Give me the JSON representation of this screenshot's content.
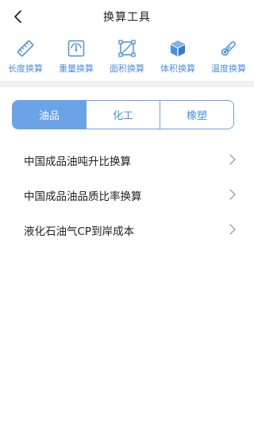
{
  "header": {
    "title": "换算工具"
  },
  "toolbar": {
    "items": [
      {
        "label": "长度换算",
        "icon": "ruler-icon"
      },
      {
        "label": "重量换算",
        "icon": "scale-icon"
      },
      {
        "label": "面积换算",
        "icon": "area-icon"
      },
      {
        "label": "体积换算",
        "icon": "cube-icon"
      },
      {
        "label": "温度换算",
        "icon": "thermometer-icon"
      }
    ]
  },
  "tabs": [
    {
      "label": "油品",
      "active": true
    },
    {
      "label": "化工",
      "active": false
    },
    {
      "label": "橡塑",
      "active": false
    }
  ],
  "list": [
    {
      "label": "中国成品油吨升比换算"
    },
    {
      "label": "中国成品油品质比率换算"
    },
    {
      "label": "液化石油气CP到岸成本"
    }
  ],
  "colors": {
    "accent": "#6aa3e6",
    "icon_blue": "#4a8fe0",
    "divider": "#eef2f6"
  }
}
